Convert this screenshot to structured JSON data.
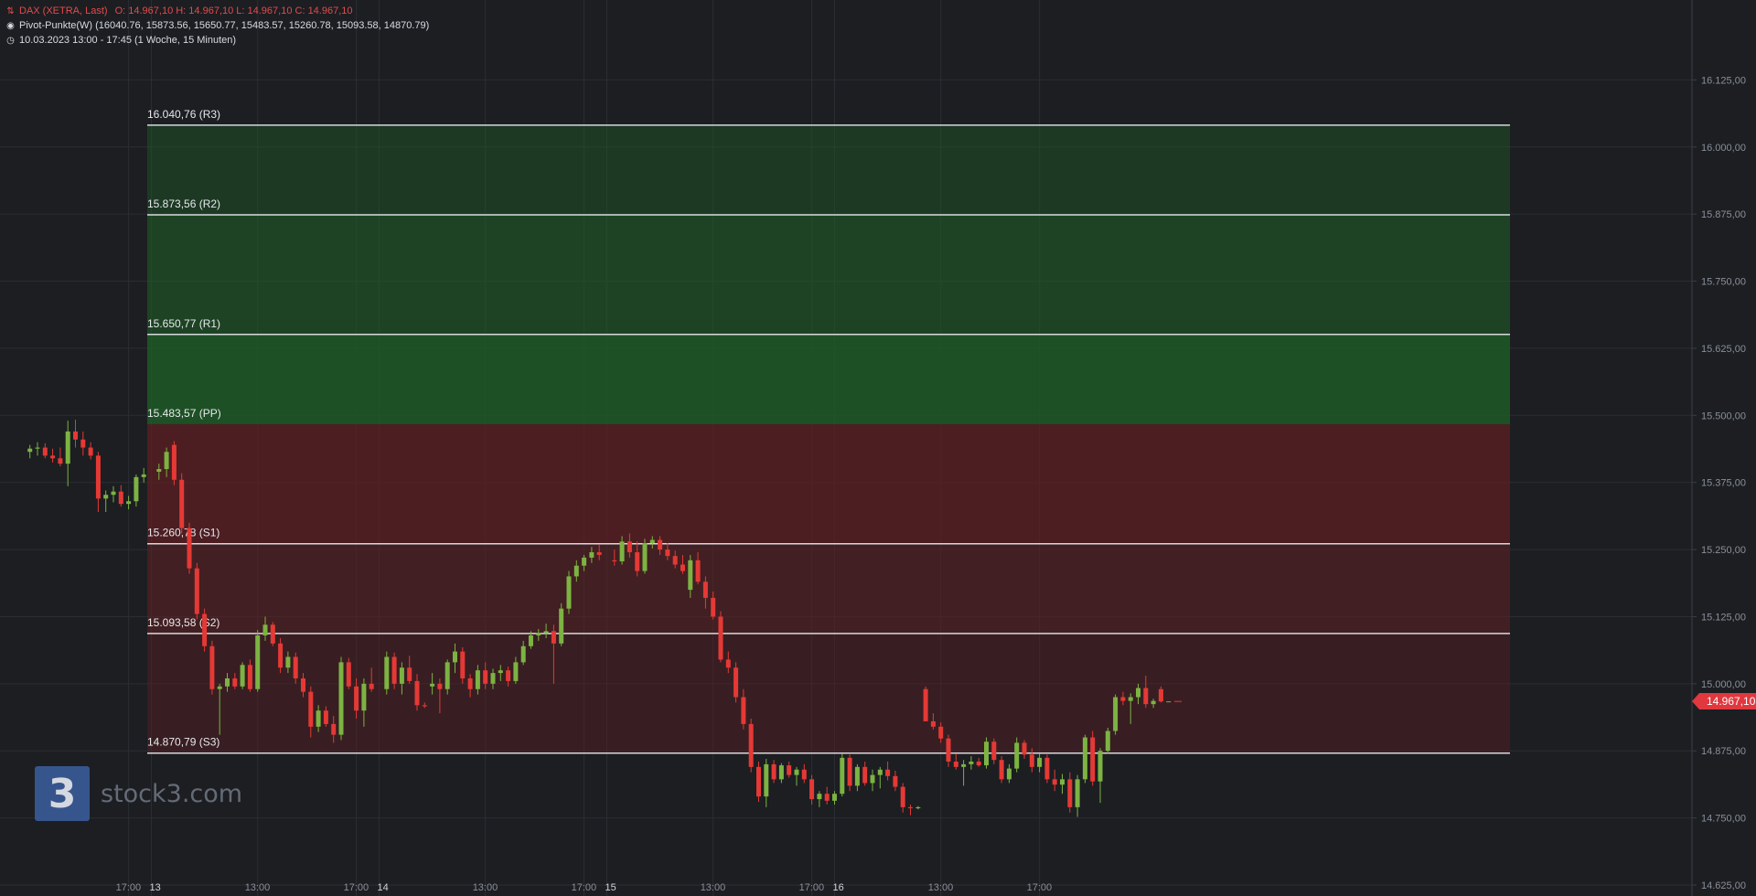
{
  "legend": {
    "instrument": "DAX (XETRA, Last)",
    "ohlc": "O: 14.967,10  H: 14.967,10  L: 14.967,10  C: 14.967,10",
    "indicator": "Pivot-Punkte(W)  (16040.76,  15873.56,  15650.77,  15483.57,  15260.78,  15093.58,  14870.79)",
    "range": "10.03.2023 13:00 - 17:45   (1 Woche, 15 Minuten)"
  },
  "last_price_label": "14.967,10",
  "watermark": {
    "logo_char": "3",
    "text": "stock3.com"
  },
  "colors": {
    "up": "#7cb342",
    "down": "#e53935",
    "resistance_zone": "#1f5c27",
    "support_zone": "#5c1f23",
    "pivot_line": "#d8dadf",
    "grid": "#2a2d33",
    "axis_text": "#8a8f99"
  },
  "chart_data": {
    "type": "candlestick",
    "title": "DAX (XETRA, Last)",
    "timeframe": "15 Minuten",
    "ylim": [
      14625,
      16250
    ],
    "y_ticks": [
      {
        "v": 14625,
        "label": "14.625,00"
      },
      {
        "v": 14750,
        "label": "14.750,00"
      },
      {
        "v": 14875,
        "label": "14.875,00"
      },
      {
        "v": 15000,
        "label": "15.000,00"
      },
      {
        "v": 15125,
        "label": "15.125,00"
      },
      {
        "v": 15250,
        "label": "15.250,00"
      },
      {
        "v": 15375,
        "label": "15.375,00"
      },
      {
        "v": 15500,
        "label": "15.500,00"
      },
      {
        "v": 15625,
        "label": "15.625,00"
      },
      {
        "v": 15750,
        "label": "15.750,00"
      },
      {
        "v": 15875,
        "label": "15.875,00"
      },
      {
        "v": 16000,
        "label": "16.000,00"
      },
      {
        "v": 16125,
        "label": "16.125,00"
      }
    ],
    "x_ticks": [
      {
        "i": -3,
        "label": "17:00"
      },
      {
        "i": 0,
        "label": "13"
      },
      {
        "i": 14,
        "label": "13:00"
      },
      {
        "i": 27,
        "label": "17:00"
      },
      {
        "i": 30,
        "label": "14"
      },
      {
        "i": 44,
        "label": "13:00"
      },
      {
        "i": 57,
        "label": "17:00"
      },
      {
        "i": 60,
        "label": "15"
      },
      {
        "i": 74,
        "label": "13:00"
      },
      {
        "i": 87,
        "label": "17:00"
      },
      {
        "i": 90,
        "label": "16"
      },
      {
        "i": 104,
        "label": "13:00"
      },
      {
        "i": 117,
        "label": "17:00"
      }
    ],
    "pivots": [
      {
        "name": "R3",
        "value": 16040.76,
        "label": "16.040,76 (R3)"
      },
      {
        "name": "R2",
        "value": 15873.56,
        "label": "15.873,56 (R2)"
      },
      {
        "name": "R1",
        "value": 15650.77,
        "label": "15.650,77 (R1)"
      },
      {
        "name": "PP",
        "value": 15483.57,
        "label": "15.483,57 (PP)"
      },
      {
        "name": "S1",
        "value": 15260.78,
        "label": "15.260,78 (S1)"
      },
      {
        "name": "S2",
        "value": 15093.58,
        "label": "15.093,58 (S2)"
      },
      {
        "name": "S3",
        "value": 14870.79,
        "label": "14.870,79 (S3)"
      }
    ],
    "last_price": 14967.1,
    "candles": [
      {
        "i": -16,
        "o": 15432,
        "h": 15445,
        "l": 15420,
        "c": 15438
      },
      {
        "i": -15,
        "o": 15438,
        "h": 15450,
        "l": 15425,
        "c": 15440
      },
      {
        "i": -14,
        "o": 15440,
        "h": 15448,
        "l": 15420,
        "c": 15425
      },
      {
        "i": -13,
        "o": 15425,
        "h": 15438,
        "l": 15412,
        "c": 15420
      },
      {
        "i": -12,
        "o": 15420,
        "h": 15440,
        "l": 15405,
        "c": 15410
      },
      {
        "i": -11,
        "o": 15410,
        "h": 15490,
        "l": 15368,
        "c": 15470
      },
      {
        "i": -10,
        "o": 15470,
        "h": 15492,
        "l": 15440,
        "c": 15455
      },
      {
        "i": -9,
        "o": 15455,
        "h": 15470,
        "l": 15425,
        "c": 15440
      },
      {
        "i": -8,
        "o": 15440,
        "h": 15450,
        "l": 15418,
        "c": 15425
      },
      {
        "i": -7,
        "o": 15425,
        "h": 15432,
        "l": 15320,
        "c": 15345
      },
      {
        "i": -6,
        "o": 15345,
        "h": 15360,
        "l": 15320,
        "c": 15352
      },
      {
        "i": -5,
        "o": 15352,
        "h": 15368,
        "l": 15338,
        "c": 15358
      },
      {
        "i": -4,
        "o": 15358,
        "h": 15370,
        "l": 15330,
        "c": 15335
      },
      {
        "i": -3,
        "o": 15335,
        "h": 15350,
        "l": 15325,
        "c": 15340
      },
      {
        "i": -2,
        "o": 15340,
        "h": 15390,
        "l": 15330,
        "c": 15385
      },
      {
        "i": -1,
        "o": 15385,
        "h": 15402,
        "l": 15375,
        "c": 15390
      },
      {
        "i": 1,
        "o": 15395,
        "h": 15410,
        "l": 15380,
        "c": 15400
      },
      {
        "i": 2,
        "o": 15400,
        "h": 15440,
        "l": 15385,
        "c": 15432
      },
      {
        "i": 3,
        "o": 15445,
        "h": 15452,
        "l": 15370,
        "c": 15380
      },
      {
        "i": 4,
        "o": 15380,
        "h": 15392,
        "l": 15280,
        "c": 15290
      },
      {
        "i": 5,
        "o": 15290,
        "h": 15300,
        "l": 15205,
        "c": 15215
      },
      {
        "i": 6,
        "o": 15215,
        "h": 15225,
        "l": 15120,
        "c": 15130
      },
      {
        "i": 7,
        "o": 15130,
        "h": 15140,
        "l": 15060,
        "c": 15070
      },
      {
        "i": 8,
        "o": 15070,
        "h": 15080,
        "l": 14980,
        "c": 14990
      },
      {
        "i": 9,
        "o": 14990,
        "h": 15000,
        "l": 14905,
        "c": 14995
      },
      {
        "i": 10,
        "o": 14995,
        "h": 15020,
        "l": 14985,
        "c": 15010
      },
      {
        "i": 11,
        "o": 15010,
        "h": 15020,
        "l": 14990,
        "c": 14995
      },
      {
        "i": 12,
        "o": 14995,
        "h": 15040,
        "l": 14990,
        "c": 15035
      },
      {
        "i": 13,
        "o": 15035,
        "h": 15045,
        "l": 14985,
        "c": 14990
      },
      {
        "i": 14,
        "o": 14990,
        "h": 15100,
        "l": 14985,
        "c": 15090
      },
      {
        "i": 15,
        "o": 15090,
        "h": 15125,
        "l": 15080,
        "c": 15110
      },
      {
        "i": 16,
        "o": 15110,
        "h": 15115,
        "l": 15070,
        "c": 15075
      },
      {
        "i": 17,
        "o": 15075,
        "h": 15085,
        "l": 15020,
        "c": 15030
      },
      {
        "i": 18,
        "o": 15030,
        "h": 15060,
        "l": 15020,
        "c": 15050
      },
      {
        "i": 19,
        "o": 15050,
        "h": 15058,
        "l": 15000,
        "c": 15010
      },
      {
        "i": 20,
        "o": 15010,
        "h": 15020,
        "l": 14975,
        "c": 14985
      },
      {
        "i": 21,
        "o": 14985,
        "h": 14995,
        "l": 14900,
        "c": 14920
      },
      {
        "i": 22,
        "o": 14920,
        "h": 14960,
        "l": 14910,
        "c": 14950
      },
      {
        "i": 23,
        "o": 14950,
        "h": 14958,
        "l": 14920,
        "c": 14925
      },
      {
        "i": 24,
        "o": 14925,
        "h": 14940,
        "l": 14890,
        "c": 14905
      },
      {
        "i": 25,
        "o": 14905,
        "h": 15050,
        "l": 14895,
        "c": 15040
      },
      {
        "i": 26,
        "o": 15040,
        "h": 15048,
        "l": 14990,
        "c": 14995
      },
      {
        "i": 27,
        "o": 14995,
        "h": 15010,
        "l": 14935,
        "c": 14950
      },
      {
        "i": 28,
        "o": 14950,
        "h": 15010,
        "l": 14920,
        "c": 15000
      },
      {
        "i": 29,
        "o": 15000,
        "h": 15030,
        "l": 14985,
        "c": 14990
      },
      {
        "i": 31,
        "o": 14990,
        "h": 15060,
        "l": 14980,
        "c": 15050
      },
      {
        "i": 32,
        "o": 15050,
        "h": 15058,
        "l": 14990,
        "c": 15000
      },
      {
        "i": 33,
        "o": 15000,
        "h": 15040,
        "l": 14980,
        "c": 15030
      },
      {
        "i": 34,
        "o": 15030,
        "h": 15052,
        "l": 15000,
        "c": 15005
      },
      {
        "i": 35,
        "o": 15005,
        "h": 15018,
        "l": 14950,
        "c": 14960
      },
      {
        "i": 36,
        "o": 14960,
        "h": 14965,
        "l": 14955,
        "c": 14958
      },
      {
        "i": 37,
        "o": 14995,
        "h": 15020,
        "l": 14980,
        "c": 15000
      },
      {
        "i": 38,
        "o": 15000,
        "h": 15010,
        "l": 14945,
        "c": 14990
      },
      {
        "i": 39,
        "o": 14990,
        "h": 15045,
        "l": 14980,
        "c": 15040
      },
      {
        "i": 40,
        "o": 15040,
        "h": 15075,
        "l": 15020,
        "c": 15060
      },
      {
        "i": 41,
        "o": 15060,
        "h": 15068,
        "l": 15000,
        "c": 15010
      },
      {
        "i": 42,
        "o": 15010,
        "h": 15018,
        "l": 14975,
        "c": 14990
      },
      {
        "i": 43,
        "o": 14990,
        "h": 15035,
        "l": 14980,
        "c": 15025
      },
      {
        "i": 44,
        "o": 15025,
        "h": 15040,
        "l": 14990,
        "c": 15000
      },
      {
        "i": 45,
        "o": 15000,
        "h": 15028,
        "l": 14990,
        "c": 15020
      },
      {
        "i": 46,
        "o": 15020,
        "h": 15035,
        "l": 15005,
        "c": 15025
      },
      {
        "i": 47,
        "o": 15025,
        "h": 15032,
        "l": 14995,
        "c": 15005
      },
      {
        "i": 48,
        "o": 15005,
        "h": 15050,
        "l": 15000,
        "c": 15040
      },
      {
        "i": 49,
        "o": 15040,
        "h": 15080,
        "l": 15035,
        "c": 15070
      },
      {
        "i": 50,
        "o": 15070,
        "h": 15098,
        "l": 15065,
        "c": 15090
      },
      {
        "i": 51,
        "o": 15090,
        "h": 15102,
        "l": 15080,
        "c": 15095
      },
      {
        "i": 52,
        "o": 15095,
        "h": 15112,
        "l": 15085,
        "c": 15098
      },
      {
        "i": 53,
        "o": 15098,
        "h": 15110,
        "l": 15000,
        "c": 15075
      },
      {
        "i": 54,
        "o": 15075,
        "h": 15150,
        "l": 15070,
        "c": 15140
      },
      {
        "i": 55,
        "o": 15140,
        "h": 15210,
        "l": 15130,
        "c": 15200
      },
      {
        "i": 56,
        "o": 15200,
        "h": 15230,
        "l": 15190,
        "c": 15220
      },
      {
        "i": 57,
        "o": 15220,
        "h": 15240,
        "l": 15210,
        "c": 15235
      },
      {
        "i": 58,
        "o": 15235,
        "h": 15255,
        "l": 15225,
        "c": 15245
      },
      {
        "i": 59,
        "o": 15245,
        "h": 15260,
        "l": 15230,
        "c": 15240
      },
      {
        "i": 61,
        "o": 15230,
        "h": 15250,
        "l": 15220,
        "c": 15228
      },
      {
        "i": 62,
        "o": 15228,
        "h": 15275,
        "l": 15222,
        "c": 15265
      },
      {
        "i": 63,
        "o": 15265,
        "h": 15280,
        "l": 15235,
        "c": 15245
      },
      {
        "i": 64,
        "o": 15245,
        "h": 15265,
        "l": 15200,
        "c": 15210
      },
      {
        "i": 65,
        "o": 15210,
        "h": 15270,
        "l": 15205,
        "c": 15262
      },
      {
        "i": 66,
        "o": 15262,
        "h": 15275,
        "l": 15252,
        "c": 15268
      },
      {
        "i": 67,
        "o": 15268,
        "h": 15275,
        "l": 15240,
        "c": 15250
      },
      {
        "i": 68,
        "o": 15250,
        "h": 15262,
        "l": 15230,
        "c": 15238
      },
      {
        "i": 69,
        "o": 15238,
        "h": 15248,
        "l": 15215,
        "c": 15222
      },
      {
        "i": 70,
        "o": 15222,
        "h": 15240,
        "l": 15205,
        "c": 15210
      },
      {
        "i": 71,
        "o": 15175,
        "h": 15240,
        "l": 15160,
        "c": 15230
      },
      {
        "i": 72,
        "o": 15230,
        "h": 15245,
        "l": 15185,
        "c": 15190
      },
      {
        "i": 73,
        "o": 15190,
        "h": 15200,
        "l": 15140,
        "c": 15160
      },
      {
        "i": 74,
        "o": 15160,
        "h": 15172,
        "l": 15120,
        "c": 15125
      },
      {
        "i": 75,
        "o": 15125,
        "h": 15135,
        "l": 15040,
        "c": 15045
      },
      {
        "i": 76,
        "o": 15045,
        "h": 15060,
        "l": 15020,
        "c": 15030
      },
      {
        "i": 77,
        "o": 15030,
        "h": 15040,
        "l": 14965,
        "c": 14975
      },
      {
        "i": 78,
        "o": 14975,
        "h": 14990,
        "l": 14915,
        "c": 14925
      },
      {
        "i": 79,
        "o": 14925,
        "h": 14935,
        "l": 14835,
        "c": 14845
      },
      {
        "i": 80,
        "o": 14845,
        "h": 14855,
        "l": 14780,
        "c": 14790
      },
      {
        "i": 81,
        "o": 14790,
        "h": 14860,
        "l": 14770,
        "c": 14850
      },
      {
        "i": 82,
        "o": 14850,
        "h": 14858,
        "l": 14815,
        "c": 14822
      },
      {
        "i": 83,
        "o": 14822,
        "h": 14852,
        "l": 14815,
        "c": 14848
      },
      {
        "i": 84,
        "o": 14848,
        "h": 14855,
        "l": 14825,
        "c": 14830
      },
      {
        "i": 85,
        "o": 14830,
        "h": 14845,
        "l": 14810,
        "c": 14840
      },
      {
        "i": 86,
        "o": 14840,
        "h": 14850,
        "l": 14815,
        "c": 14822
      },
      {
        "i": 87,
        "o": 14822,
        "h": 14830,
        "l": 14775,
        "c": 14785
      },
      {
        "i": 88,
        "o": 14785,
        "h": 14800,
        "l": 14770,
        "c": 14795
      },
      {
        "i": 89,
        "o": 14795,
        "h": 14808,
        "l": 14775,
        "c": 14782
      },
      {
        "i": 90,
        "o": 14782,
        "h": 14800,
        "l": 14775,
        "c": 14795
      },
      {
        "i": 91,
        "o": 14795,
        "h": 14870,
        "l": 14790,
        "c": 14862
      },
      {
        "i": 92,
        "o": 14862,
        "h": 14868,
        "l": 14800,
        "c": 14810
      },
      {
        "i": 93,
        "o": 14810,
        "h": 14850,
        "l": 14800,
        "c": 14845
      },
      {
        "i": 94,
        "o": 14845,
        "h": 14855,
        "l": 14810,
        "c": 14815
      },
      {
        "i": 95,
        "o": 14815,
        "h": 14840,
        "l": 14800,
        "c": 14830
      },
      {
        "i": 96,
        "o": 14830,
        "h": 14845,
        "l": 14805,
        "c": 14840
      },
      {
        "i": 97,
        "o": 14840,
        "h": 14855,
        "l": 14820,
        "c": 14828
      },
      {
        "i": 98,
        "o": 14828,
        "h": 14838,
        "l": 14800,
        "c": 14808
      },
      {
        "i": 99,
        "o": 14808,
        "h": 14815,
        "l": 14760,
        "c": 14770
      },
      {
        "i": 100,
        "o": 14770,
        "h": 14775,
        "l": 14755,
        "c": 14768
      },
      {
        "i": 101,
        "o": 14768,
        "h": 14772,
        "l": 14766,
        "c": 14770
      },
      {
        "i": 102,
        "o": 14990,
        "h": 14995,
        "l": 14970,
        "c": 14930
      },
      {
        "i": 103,
        "o": 14930,
        "h": 14945,
        "l": 14915,
        "c": 14920
      },
      {
        "i": 104,
        "o": 14920,
        "h": 14928,
        "l": 14890,
        "c": 14898
      },
      {
        "i": 105,
        "o": 14898,
        "h": 14905,
        "l": 14845,
        "c": 14855
      },
      {
        "i": 106,
        "o": 14855,
        "h": 14870,
        "l": 14840,
        "c": 14845
      },
      {
        "i": 107,
        "o": 14845,
        "h": 14858,
        "l": 14810,
        "c": 14850
      },
      {
        "i": 108,
        "o": 14850,
        "h": 14865,
        "l": 14840,
        "c": 14855
      },
      {
        "i": 109,
        "o": 14855,
        "h": 14862,
        "l": 14845,
        "c": 14848
      },
      {
        "i": 110,
        "o": 14848,
        "h": 14900,
        "l": 14842,
        "c": 14892
      },
      {
        "i": 111,
        "o": 14892,
        "h": 14898,
        "l": 14850,
        "c": 14858
      },
      {
        "i": 112,
        "o": 14858,
        "h": 14865,
        "l": 14815,
        "c": 14822
      },
      {
        "i": 113,
        "o": 14822,
        "h": 14850,
        "l": 14815,
        "c": 14842
      },
      {
        "i": 114,
        "o": 14842,
        "h": 14900,
        "l": 14835,
        "c": 14890
      },
      {
        "i": 115,
        "o": 14890,
        "h": 14895,
        "l": 14860,
        "c": 14868
      },
      {
        "i": 116,
        "o": 14868,
        "h": 14880,
        "l": 14835,
        "c": 14845
      },
      {
        "i": 117,
        "o": 14845,
        "h": 14870,
        "l": 14835,
        "c": 14862
      },
      {
        "i": 118,
        "o": 14862,
        "h": 14868,
        "l": 14815,
        "c": 14822
      },
      {
        "i": 119,
        "o": 14822,
        "h": 14840,
        "l": 14800,
        "c": 14812
      },
      {
        "i": 120,
        "o": 14812,
        "h": 14832,
        "l": 14795,
        "c": 14822
      },
      {
        "i": 121,
        "o": 14822,
        "h": 14835,
        "l": 14760,
        "c": 14770
      },
      {
        "i": 122,
        "o": 14770,
        "h": 14830,
        "l": 14752,
        "c": 14822
      },
      {
        "i": 123,
        "o": 14822,
        "h": 14905,
        "l": 14815,
        "c": 14900
      },
      {
        "i": 124,
        "o": 14900,
        "h": 14912,
        "l": 14810,
        "c": 14818
      },
      {
        "i": 125,
        "o": 14818,
        "h": 14880,
        "l": 14778,
        "c": 14875
      },
      {
        "i": 126,
        "o": 14875,
        "h": 14918,
        "l": 14870,
        "c": 14912
      },
      {
        "i": 127,
        "o": 14912,
        "h": 14980,
        "l": 14905,
        "c": 14975
      },
      {
        "i": 128,
        "o": 14975,
        "h": 14985,
        "l": 14960,
        "c": 14968
      },
      {
        "i": 129,
        "o": 14968,
        "h": 14982,
        "l": 14925,
        "c": 14975
      },
      {
        "i": 130,
        "o": 14975,
        "h": 15000,
        "l": 14962,
        "c": 14992
      },
      {
        "i": 131,
        "o": 14992,
        "h": 15015,
        "l": 14955,
        "c": 14962
      },
      {
        "i": 132,
        "o": 14962,
        "h": 14972,
        "l": 14955,
        "c": 14968
      },
      {
        "i": 133,
        "o": 14990,
        "h": 14995,
        "l": 14965,
        "c": 14967
      },
      {
        "i": 134,
        "o": 14967.1,
        "h": 14967.1,
        "l": 14967.1,
        "c": 14967.1
      }
    ]
  }
}
